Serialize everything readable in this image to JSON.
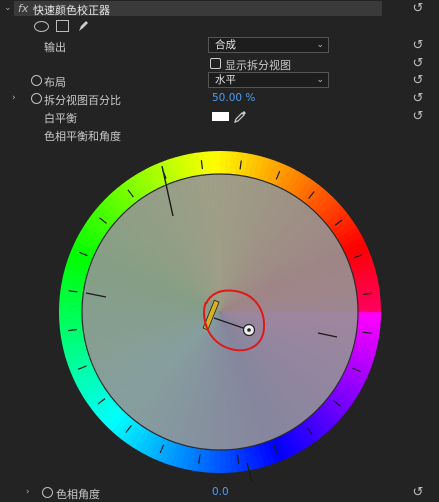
{
  "header": {
    "fx_label": "fx",
    "title": "快速颜色校正器",
    "reset_glyph": "↺"
  },
  "mask_tools": [
    "ellipse-mask",
    "rectangle-mask",
    "pen-mask"
  ],
  "params": {
    "output": {
      "label": "输出",
      "value": "合成"
    },
    "show_split": {
      "label": "显示拆分视图",
      "checked": false
    },
    "layout": {
      "label": "布局",
      "value": "水平"
    },
    "split_percent": {
      "label": "拆分视图百分比",
      "value": "50.00 %"
    },
    "white_balance": {
      "label": "白平衡",
      "swatch": "#ffffff"
    },
    "hue_balance": {
      "label": "色相平衡和角度"
    },
    "hue_angle": {
      "label": "色相角度",
      "value": "0.0"
    }
  },
  "colors": {
    "accent_value": "#4a9cf0",
    "annotation": "#e01818"
  }
}
